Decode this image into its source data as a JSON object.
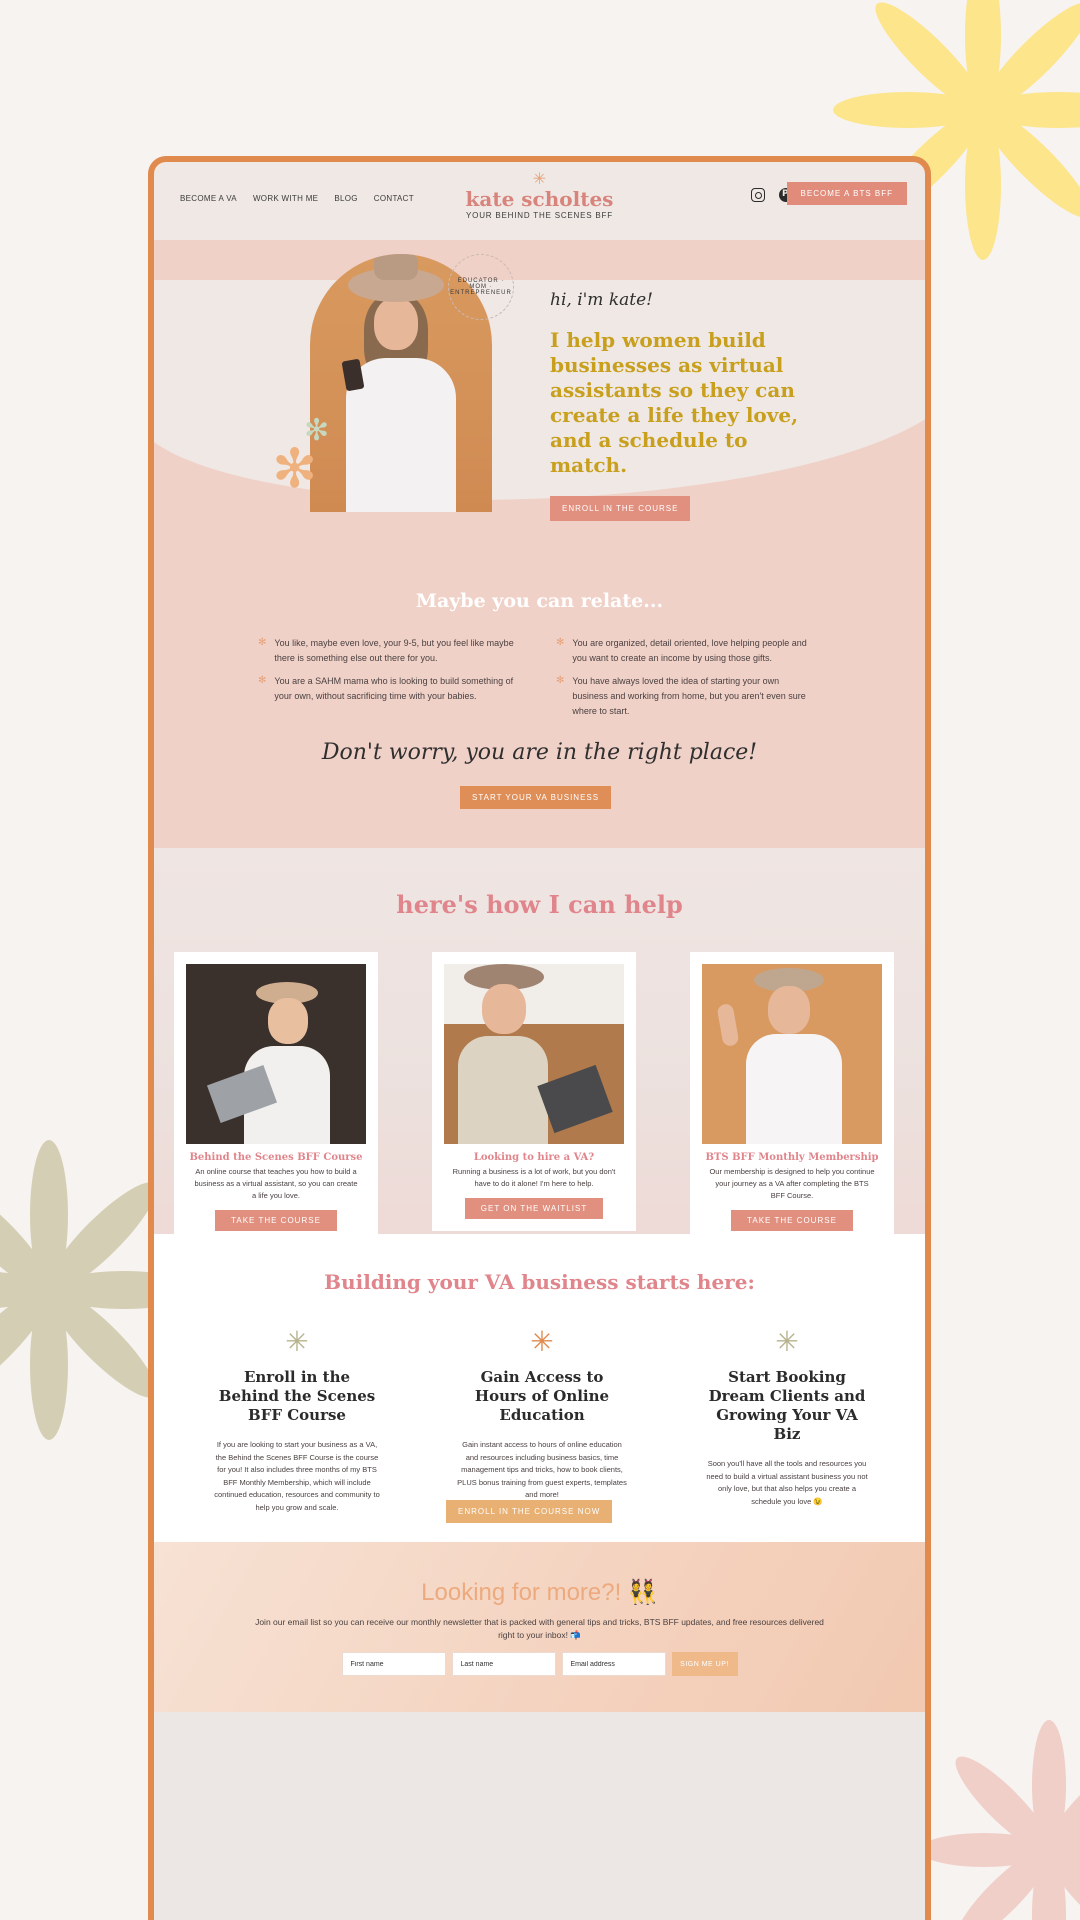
{
  "nav": {
    "links": [
      "BECOME A VA",
      "WORK WITH ME",
      "BLOG",
      "CONTACT"
    ],
    "logo_name": "kate scholtes",
    "logo_tagline": "YOUR BEHIND THE SCENES BFF",
    "cta": "BECOME A BTS BFF"
  },
  "hero": {
    "circle_text": "EDUCATOR · MOM · ENTREPRENEUR",
    "greeting": "hi, i'm kate!",
    "headline": "I help women build businesses as virtual assistants so they can create a life they love, and a schedule to match.",
    "button": "ENROLL IN THE COURSE"
  },
  "relate": {
    "title": "Maybe you can relate...",
    "left_items": [
      "You like, maybe even love, your 9-5, but you feel like maybe there is something else out there for you.",
      "You are a SAHM mama who is looking to build something of your own, without sacrificing time with your babies."
    ],
    "right_items": [
      "You are organized, detail oriented, love helping people and you want to create an income by using those gifts.",
      "You have always loved the idea of starting your own business and working from home, but you aren't even sure where to start."
    ],
    "script": "Don't worry, you are in the right place!",
    "button": "START YOUR VA BUSINESS"
  },
  "help": {
    "title": "here's how I can help",
    "cards": [
      {
        "title": "Behind the Scenes BFF Course",
        "text": "An online course that teaches you how to build a business as a virtual assistant, so you can create a life you love.",
        "button": "TAKE THE COURSE"
      },
      {
        "title": "Looking to hire a VA?",
        "text": "Running a business is a lot of work, but you don't have to do it alone! I'm here to help.",
        "button": "GET ON THE WAITLIST"
      },
      {
        "title": "BTS BFF Monthly Membership",
        "text": "Our membership is designed to help you continue your journey as a VA after completing the BTS BFF Course.",
        "button": "TAKE THE COURSE"
      }
    ]
  },
  "steps": {
    "title": "Building your VA business starts here:",
    "items": [
      {
        "title": "Enroll in the Behind the Scenes BFF Course",
        "text": "If you are looking to start your business as a VA, the Behind the Scenes BFF Course is the course for you! It also includes three months of my BTS BFF Monthly Membership, which will include continued education, resources and community to help you grow and scale.",
        "flower_color": "#b7b38e"
      },
      {
        "title": "Gain Access to Hours of Online Education",
        "text": "Gain instant access to hours of online education and resources including business basics, time management tips and tricks, how to book clients, PLUS bonus training from guest experts, templates and more!",
        "flower_color": "#e08a4e"
      },
      {
        "title": "Start Booking Dream Clients and Growing Your VA Biz",
        "text": "Soon you'll have all the tools and resources you need to build a virtual assistant business you not only love, but that also helps you create a schedule you love 😉",
        "flower_color": "#b7b38e"
      }
    ],
    "button": "ENROLL IN THE COURSE NOW"
  },
  "newsletter": {
    "title": "Looking for more?! 👯",
    "text": "Join our email list so you can receive our monthly newsletter that is packed with general tips and tricks, BTS BFF updates, and free resources delivered right to your inbox! 📬",
    "first_name": "First name",
    "last_name": "Last name",
    "email": "Email address",
    "submit": "SIGN ME UP!"
  },
  "colors": {
    "accent_pink": "#e0858b",
    "accent_orange": "#e08a4e",
    "headline_gold": "#c8a01e",
    "frame": "#e08a4e"
  }
}
